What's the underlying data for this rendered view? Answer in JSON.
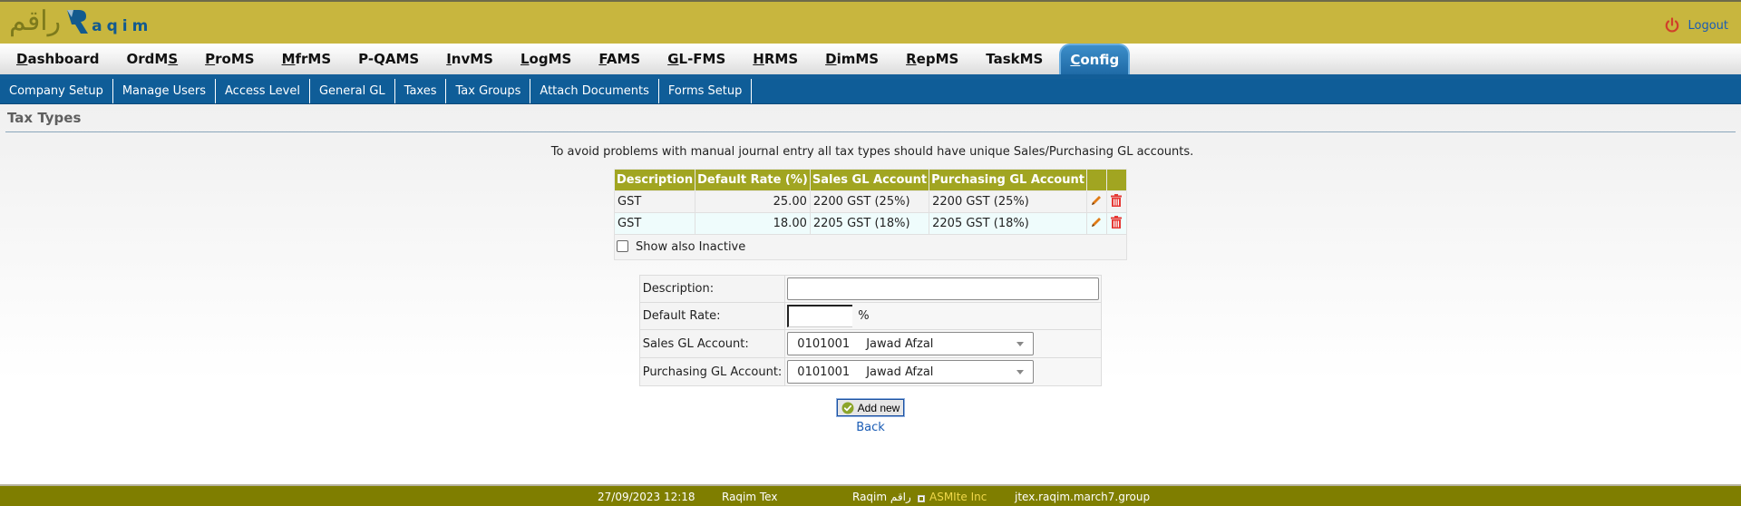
{
  "brand": {
    "logo_arabic": "راقم",
    "logo_word": "aqim",
    "colors": {
      "topbar": "#c8b63e",
      "nav_active": "#1f6aa6",
      "subnav": "#0f5d98",
      "table_header": "#a1a521",
      "footer": "#7f7e00"
    }
  },
  "header": {
    "logout_label": "Logout",
    "logout_icon": "power-icon"
  },
  "main_nav": {
    "items": [
      {
        "first": "D",
        "rest": "ashboard",
        "label": "Dashboard",
        "active": false
      },
      {
        "pre": "OrdM",
        "u": "S",
        "label": "OrdMS",
        "active": false
      },
      {
        "first": "P",
        "rest": "roMS",
        "label": "ProMS",
        "active": false
      },
      {
        "first": "M",
        "rest": "frMS",
        "label": "MfrMS",
        "active": false
      },
      {
        "first": "",
        "rest": "P-QAMS",
        "label": "P-QAMS",
        "active": false
      },
      {
        "first": "I",
        "rest": "nvMS",
        "label": "InvMS",
        "active": false
      },
      {
        "first": "L",
        "rest": "ogMS",
        "label": "LogMS",
        "active": false
      },
      {
        "first": "F",
        "rest": "AMS",
        "label": "FAMS",
        "active": false
      },
      {
        "first": "G",
        "rest": "L-FMS",
        "label": "GL-FMS",
        "active": false
      },
      {
        "first": "H",
        "rest": "RMS",
        "label": "HRMS",
        "active": false
      },
      {
        "first": "D",
        "rest": "imMS",
        "label": "DimMS",
        "active": false
      },
      {
        "first": "R",
        "rest": "epMS",
        "label": "RepMS",
        "active": false
      },
      {
        "first": "",
        "rest": "TaskMS",
        "label": "TaskMS",
        "active": false
      },
      {
        "first": "C",
        "rest": "onfig",
        "label": "Config",
        "active": true
      }
    ]
  },
  "sub_nav": {
    "items": [
      "Company Setup",
      "Manage Users",
      "Access Level",
      "General GL",
      "Taxes",
      "Tax Groups",
      "Attach Documents",
      "Forms Setup"
    ]
  },
  "page": {
    "title": "Tax Types",
    "notice": "To avoid problems with manual journal entry all tax types should have unique Sales/Purchasing GL accounts."
  },
  "tax_table": {
    "columns": [
      "Description",
      "Default Rate (%)",
      "Sales GL Account",
      "Purchasing GL Account",
      "",
      ""
    ],
    "rows": [
      {
        "description": "GST",
        "rate": "25.00",
        "sales_gl": "2200 GST (25%)",
        "purchasing_gl": "2200 GST (25%)"
      },
      {
        "description": "GST",
        "rate": "18.00",
        "sales_gl": "2205 GST (18%)",
        "purchasing_gl": "2205 GST (18%)"
      }
    ],
    "show_inactive_label": "Show also Inactive",
    "show_inactive_checked": false
  },
  "form": {
    "description_label": "Description:",
    "description_value": "",
    "rate_label": "Default Rate:",
    "rate_value": "",
    "rate_suffix": "%",
    "sales_gl_label": "Sales GL Account:",
    "sales_gl_code": "0101001",
    "sales_gl_name": "Jawad Afzal",
    "purchasing_gl_label": "Purchasing GL Account:",
    "purchasing_gl_code": "0101001",
    "purchasing_gl_name": "Jawad Afzal",
    "add_button": "Add new",
    "back_link": "Back"
  },
  "footer": {
    "datetime": "27/09/2023 12:18",
    "app_name": "Raqim Tex",
    "brand": "Raqim راقم",
    "company": "ASMIte Inc",
    "host": "jtex.raqim.march7.group"
  }
}
